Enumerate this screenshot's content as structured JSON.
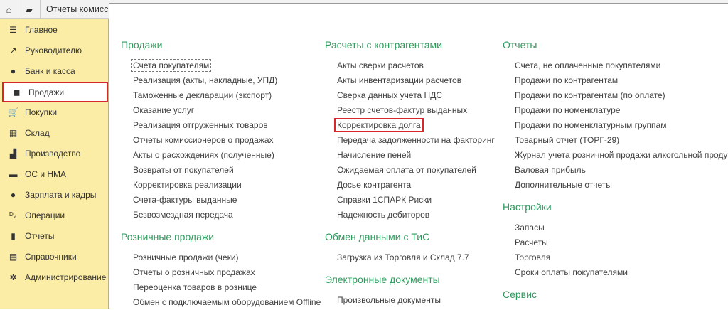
{
  "topbar": {
    "tab_title": "Отчеты комиссио"
  },
  "sidebar": [
    {
      "label": "Главное",
      "icon": "menu-icon"
    },
    {
      "label": "Руководителю",
      "icon": "trend-icon"
    },
    {
      "label": "Банк и касса",
      "icon": "ruble-icon"
    },
    {
      "label": "Продажи",
      "icon": "bag-icon"
    },
    {
      "label": "Покупки",
      "icon": "cart-icon"
    },
    {
      "label": "Склад",
      "icon": "warehouse-icon"
    },
    {
      "label": "Производство",
      "icon": "factory-icon"
    },
    {
      "label": "ОС и НМА",
      "icon": "truck-icon"
    },
    {
      "label": "Зарплата и кадры",
      "icon": "person-icon"
    },
    {
      "label": "Операции",
      "icon": "dt-kt-icon"
    },
    {
      "label": "Отчеты",
      "icon": "bar-chart-icon"
    },
    {
      "label": "Справочники",
      "icon": "books-icon"
    },
    {
      "label": "Администрирование",
      "icon": "gear-icon"
    }
  ],
  "columns": [
    {
      "sections": [
        {
          "title": "Продажи",
          "items": [
            "Счета покупателям",
            "Реализация (акты, накладные, УПД)",
            "Таможенные декларации (экспорт)",
            "Оказание услуг",
            "Реализация отгруженных товаров",
            "Отчеты комиссионеров о продажах",
            "Акты о расхождениях (полученные)",
            "Возвраты от покупателей",
            "Корректировка реализации",
            "Счета-фактуры выданные",
            "Безвозмездная передача"
          ]
        },
        {
          "title": "Розничные продажи",
          "items": [
            "Розничные продажи (чеки)",
            "Отчеты о розничных продажах",
            "Переоценка товаров в рознице",
            "Обмен с подключаемым оборудованием Offline"
          ]
        }
      ]
    },
    {
      "sections": [
        {
          "title": "Расчеты с контрагентами",
          "items": [
            "Акты сверки расчетов",
            "Акты инвентаризации расчетов",
            "Сверка данных учета НДС",
            "Реестр счетов-фактур выданных",
            "Корректировка долга",
            "Передача задолженности на факторинг",
            "Начисление пеней",
            "Ожидаемая оплата от покупателей",
            "Досье контрагента",
            "Справки 1СПАРК Риски",
            "Надежность дебиторов"
          ]
        },
        {
          "title": "Обмен данными с ТиС",
          "items": [
            "Загрузка из Торговля и Склад 7.7"
          ]
        },
        {
          "title": "Электронные документы",
          "items": [
            "Произвольные документы"
          ]
        }
      ]
    },
    {
      "sections": [
        {
          "title": "Отчеты",
          "items": [
            "Счета, не оплаченные покупателями",
            "Продажи по контрагентам",
            "Продажи по контрагентам (по оплате)",
            "Продажи по номенклатуре",
            "Продажи по номенклатурным группам",
            "Товарный отчет (ТОРГ-29)",
            "Журнал учета розничной продажи алкогольной продукции",
            "Валовая прибыль",
            "Дополнительные отчеты"
          ]
        },
        {
          "title": "Настройки",
          "items": [
            "Запасы",
            "Расчеты",
            "Торговля",
            "Сроки оплаты покупателями"
          ]
        },
        {
          "title": "Сервис",
          "items": []
        }
      ]
    }
  ]
}
